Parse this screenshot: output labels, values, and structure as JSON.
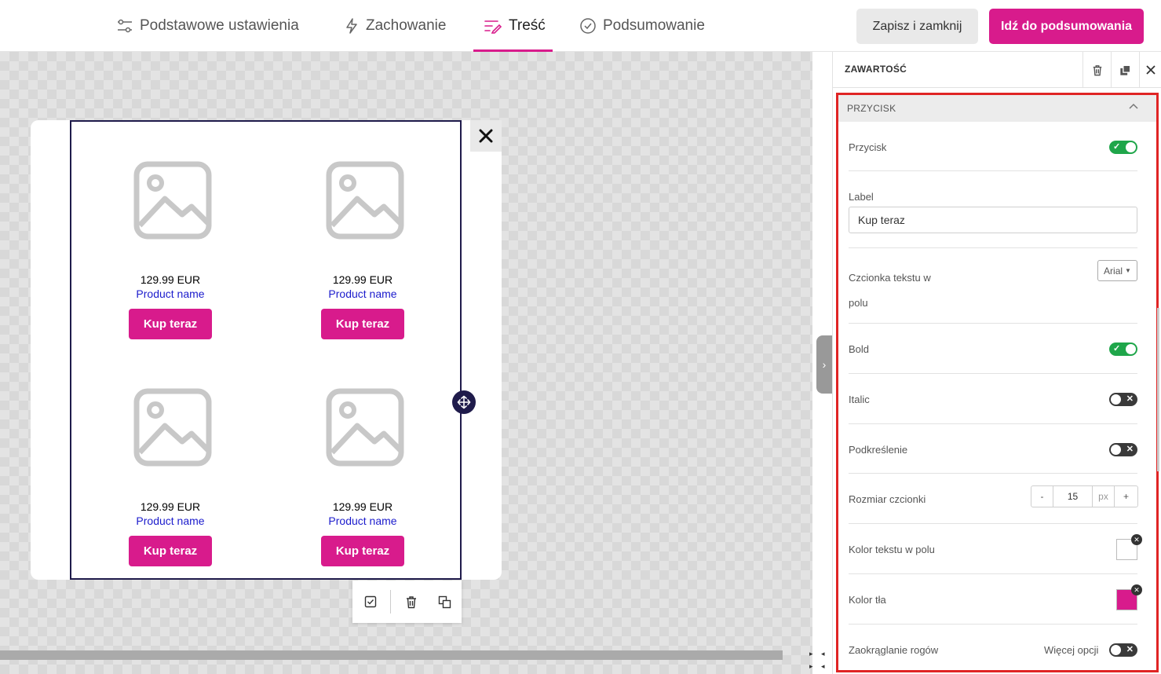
{
  "tabs": [
    {
      "label": "Podstawowe ustawienia",
      "icon": "sliders-icon"
    },
    {
      "label": "Zachowanie",
      "icon": "bolt-icon"
    },
    {
      "label": "Treść",
      "icon": "content-icon"
    },
    {
      "label": "Podsumowanie",
      "icon": "check-circle-icon"
    }
  ],
  "header": {
    "save_close": "Zapisz i zamknij",
    "go_summary": "Idź do podsumowania"
  },
  "products": [
    {
      "price": "129.99 EUR",
      "name": "Product name",
      "button": "Kup teraz"
    },
    {
      "price": "129.99 EUR",
      "name": "Product name",
      "button": "Kup teraz"
    },
    {
      "price": "129.99 EUR",
      "name": "Product name",
      "button": "Kup teraz"
    },
    {
      "price": "129.99 EUR",
      "name": "Product name",
      "button": "Kup teraz"
    }
  ],
  "panel": {
    "title": "ZAWARTOŚĆ",
    "section_title": "PRZYCISK",
    "przycisk_label": "Przycisk",
    "przycisk_on": true,
    "label_label": "Label",
    "label_value": "Kup teraz",
    "font_label_line1": "Czcionka tekstu w",
    "font_label_line2": "polu",
    "font_value": "Arial",
    "bold_label": "Bold",
    "bold_on": true,
    "italic_label": "Italic",
    "italic_on": false,
    "underline_label": "Podkreślenie",
    "underline_on": false,
    "size_label": "Rozmiar czcionki",
    "size_minus": "-",
    "size_value": "15",
    "size_unit": "px",
    "size_plus": "+",
    "text_color_label": "Kolor tekstu w polu",
    "text_color": "#ffffff",
    "bg_color_label": "Kolor tła",
    "bg_color": "#d81b8c",
    "radius_label": "Zaokrąglanie rogów",
    "more_options": "Więcej opcji",
    "radius_on": false
  },
  "colors": {
    "accent": "#d81b8c",
    "frame": "#1f1b4b",
    "link": "#1b1bcc",
    "highlight": "#e02424"
  }
}
